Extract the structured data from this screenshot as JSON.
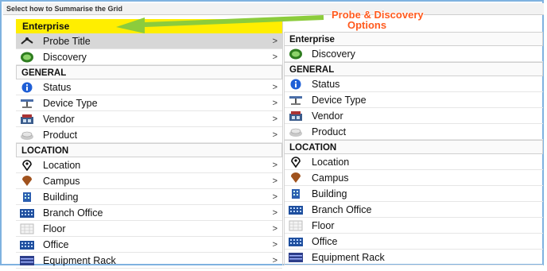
{
  "header": {
    "title": "Select how to Summarise the Grid"
  },
  "annotation": {
    "line1": "Probe & Discovery",
    "line2": "Options"
  },
  "left": {
    "enterprise": "Enterprise",
    "items_top": [
      {
        "label": "Probe Title",
        "icon": "probe-icon",
        "chevron": ">"
      },
      {
        "label": "Discovery",
        "icon": "discovery-icon",
        "chevron": ">"
      }
    ],
    "general": "GENERAL",
    "items_general": [
      {
        "label": "Status",
        "icon": "info-icon",
        "chevron": ">"
      },
      {
        "label": "Device Type",
        "icon": "device-type-icon",
        "chevron": ">"
      },
      {
        "label": "Vendor",
        "icon": "vendor-icon",
        "chevron": ">"
      },
      {
        "label": "Product",
        "icon": "product-icon",
        "chevron": ">"
      }
    ],
    "location": "LOCATION",
    "items_location": [
      {
        "label": "Location",
        "icon": "location-pin-icon",
        "chevron": ">"
      },
      {
        "label": "Campus",
        "icon": "campus-icon",
        "chevron": ">"
      },
      {
        "label": "Building",
        "icon": "building-icon",
        "chevron": ">"
      },
      {
        "label": "Branch Office",
        "icon": "branch-office-icon",
        "chevron": ">"
      },
      {
        "label": "Floor",
        "icon": "floor-icon",
        "chevron": ">"
      },
      {
        "label": "Office",
        "icon": "office-icon",
        "chevron": ">"
      },
      {
        "label": "Equipment Rack",
        "icon": "equipment-rack-icon",
        "chevron": ">"
      }
    ]
  },
  "right": {
    "enterprise": "Enterprise",
    "items_top": [
      {
        "label": "Discovery",
        "icon": "discovery-icon"
      }
    ],
    "general": "GENERAL",
    "items_general": [
      {
        "label": "Status",
        "icon": "info-icon"
      },
      {
        "label": "Device Type",
        "icon": "device-type-icon"
      },
      {
        "label": "Vendor",
        "icon": "vendor-icon"
      },
      {
        "label": "Product",
        "icon": "product-icon"
      }
    ],
    "location": "LOCATION",
    "items_location": [
      {
        "label": "Location",
        "icon": "location-pin-icon"
      },
      {
        "label": "Campus",
        "icon": "campus-icon"
      },
      {
        "label": "Building",
        "icon": "building-icon"
      },
      {
        "label": "Branch Office",
        "icon": "branch-office-icon"
      },
      {
        "label": "Floor",
        "icon": "floor-icon"
      },
      {
        "label": "Office",
        "icon": "office-icon"
      },
      {
        "label": "Equipment Rack",
        "icon": "equipment-rack-icon"
      }
    ]
  },
  "colors": {
    "highlight": "#ffee00",
    "annotation": "#ff5a1e",
    "arrow": "#8ccc3c",
    "frame": "#7fb2e0",
    "selected_row": "#d7d7d7"
  }
}
